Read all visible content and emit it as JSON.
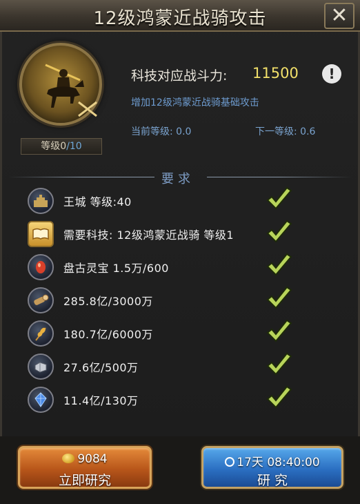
{
  "window": {
    "title": "12级鸿蒙近战骑攻击"
  },
  "tech": {
    "level_prefix": "等级",
    "level_current": "0",
    "level_max": "/10",
    "power_label": "科技对应战斗力:",
    "power_value": "11500",
    "description": "增加12级鸿蒙近战骑基础攻击",
    "current_level": "当前等级: 0.0",
    "next_level": "下一等级: 0.6"
  },
  "requirements": {
    "title": "要求",
    "items": [
      {
        "icon": "castle-icon",
        "text": "王城  等级:40"
      },
      {
        "icon": "book-icon",
        "text": "需要科技: 12级鸿蒙近战骑  等级1"
      },
      {
        "icon": "red-gem-icon",
        "text": "盘古灵宝  1.5万/600"
      },
      {
        "icon": "wood-log-icon",
        "text": "285.8亿/3000万"
      },
      {
        "icon": "wheat-icon",
        "text": "180.7亿/6000万"
      },
      {
        "icon": "iron-ore-icon",
        "text": "27.6亿/500万"
      },
      {
        "icon": "blue-crystal-icon",
        "text": "11.4亿/130万"
      }
    ]
  },
  "actions": {
    "instant": {
      "cost": "9084",
      "label": "立即研究"
    },
    "research": {
      "time": "17天  08:40:00",
      "label": "研    究"
    }
  },
  "colors": {
    "accent_gold": "#f2e06a",
    "info_blue": "#7aa3cf",
    "check_green": "#b8d45a"
  }
}
